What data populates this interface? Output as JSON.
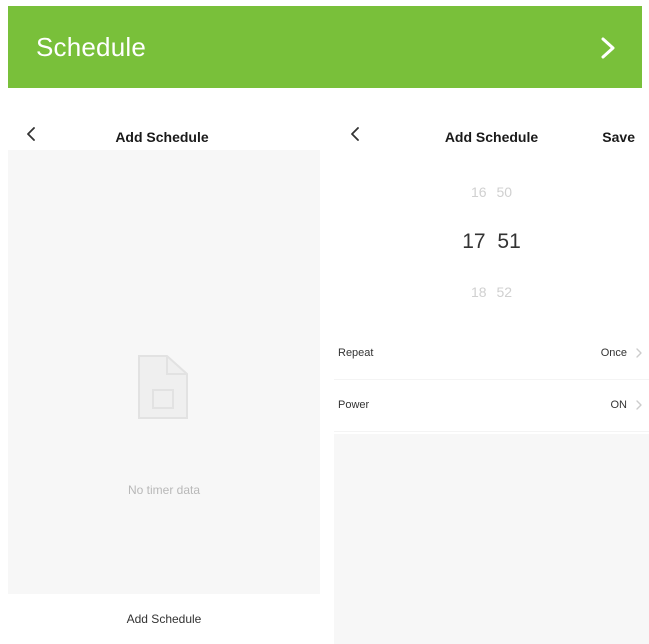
{
  "banner": {
    "title": "Schedule",
    "next_icon": "chevron-right-icon",
    "color": "#79c03a"
  },
  "left_panel": {
    "back_icon": "chevron-left-icon",
    "title": "Add Schedule",
    "empty_icon": "document-icon",
    "empty_text": "No timer data",
    "add_button": "Add Schedule"
  },
  "right_panel": {
    "back_icon": "chevron-left-icon",
    "title": "Add Schedule",
    "save_label": "Save",
    "picker": {
      "prev": {
        "hour": "16",
        "minute": "50"
      },
      "current": {
        "hour": "17",
        "minute": "51"
      },
      "next": {
        "hour": "18",
        "minute": "52"
      }
    },
    "settings": [
      {
        "label": "Repeat",
        "value": "Once"
      },
      {
        "label": "Power",
        "value": "ON"
      }
    ]
  }
}
